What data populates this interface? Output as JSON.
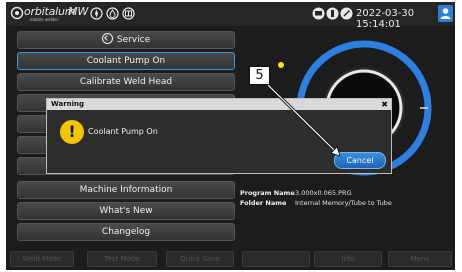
{
  "header": {
    "brand": "orbitalum",
    "model": "MW",
    "subtitle": "mobile welder",
    "datetime": "2022-03-30 15:14:01",
    "icons": [
      "compass-icon",
      "drop-icon",
      "gauge-icon",
      "monitor-icon",
      "usb-icon",
      "wrench-icon",
      "user-icon"
    ]
  },
  "menu": {
    "service": "Service",
    "coolant_pump": "Coolant Pump On",
    "calibrate": "Calibrate Weld Head",
    "machine_info": "Machine Information",
    "whats_new": "What's New",
    "changelog": "Changelog"
  },
  "info": {
    "program_label": "Program Name",
    "program_value": "3.000x0.065.PRG",
    "folder_label": "Folder Name",
    "folder_value": "Internal Memory/Tube to Tube"
  },
  "bottom_bar": [
    "Weld Mode",
    "Test Mode",
    "Quick Save",
    "",
    "Info",
    "Menu"
  ],
  "dialog": {
    "title": "Warning",
    "close": "✖",
    "message": "Coolant Pump On",
    "cancel": "Cancel"
  },
  "callout": "5",
  "colors": {
    "accent_blue": "#2f7fd6",
    "ring_blue": "#2d7fe0",
    "warning_yellow": "#f2c500",
    "status_yellow": "#ffe600"
  }
}
